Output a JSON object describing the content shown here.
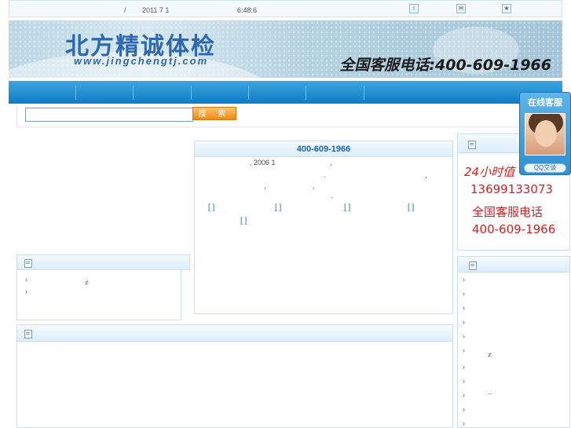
{
  "topbar": {
    "slash": "/",
    "date": "2011 7 1",
    "time": "6:48:6",
    "icons": [
      "info-icon",
      "mail-icon",
      "bookmark-icon"
    ]
  },
  "header": {
    "logo_text": "北方精诚体检",
    "logo_url": "www.jingchengtj.com",
    "hotline": "全国客服电话:400-609-1966"
  },
  "search": {
    "placeholder": "",
    "button_label": "搜 索"
  },
  "center_panel": {
    "title": "400-609-1966",
    "lines": [
      ", 2006 1",
      ",",
      ".",
      ",",
      ",",
      ",",
      "."
    ],
    "brackets": [
      "[ ]",
      "[ ]",
      "[ ]",
      "[ ]",
      "[ ]"
    ]
  },
  "left_panel": {
    "items": [
      "≠",
      ""
    ]
  },
  "right_panel": {
    "service_hours": "24小时值",
    "mobile": "13699133073",
    "hotline_label": "全国客服电话",
    "hotline": "400-609-1966"
  },
  "right_list": {
    "marks": [
      "≠",
      ".."
    ]
  },
  "qq_widget": {
    "title": "在线客服",
    "button_label": "QQ交谈"
  },
  "colors": {
    "nav_blue": "#0d7cc7",
    "logo_blue": "#2d68b3",
    "accent_orange": "#f08a12",
    "alert_red": "#e01a1a"
  }
}
